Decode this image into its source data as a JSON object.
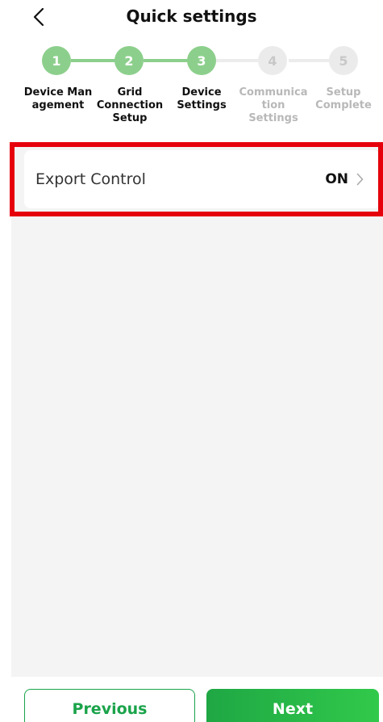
{
  "header": {
    "title": "Quick settings",
    "back_icon": "chevron-left-icon"
  },
  "stepper": {
    "steps": [
      {
        "number": "1",
        "label": "Device Man agement",
        "lines": [
          "Device Man",
          "agement"
        ],
        "state": "complete"
      },
      {
        "number": "2",
        "label": "Grid Connection Setup",
        "lines": [
          "Grid",
          "Connection",
          "Setup"
        ],
        "state": "complete"
      },
      {
        "number": "3",
        "label": "Device Settings",
        "lines": [
          "Device",
          "Settings"
        ],
        "state": "current"
      },
      {
        "number": "4",
        "label": "Communica tion Settings",
        "lines": [
          "Communica",
          "tion",
          "Settings"
        ],
        "state": "pending"
      },
      {
        "number": "5",
        "label": "Setup Complete",
        "lines": [
          "Setup",
          "Complete"
        ],
        "state": "pending"
      }
    ]
  },
  "settings": [
    {
      "label": "Export Control",
      "value": "ON",
      "icon": "chevron-right-icon"
    }
  ],
  "footer": {
    "previous_label": "Previous",
    "next_label": "Next"
  },
  "colors": {
    "done_circle": "#8ccf8c",
    "done_line": "#8ccf8c",
    "pending_circle": "#ebebeb",
    "pending_text": "#b8b8b8",
    "accent_green": "#1aa34a",
    "highlight_red": "#e6000b"
  }
}
